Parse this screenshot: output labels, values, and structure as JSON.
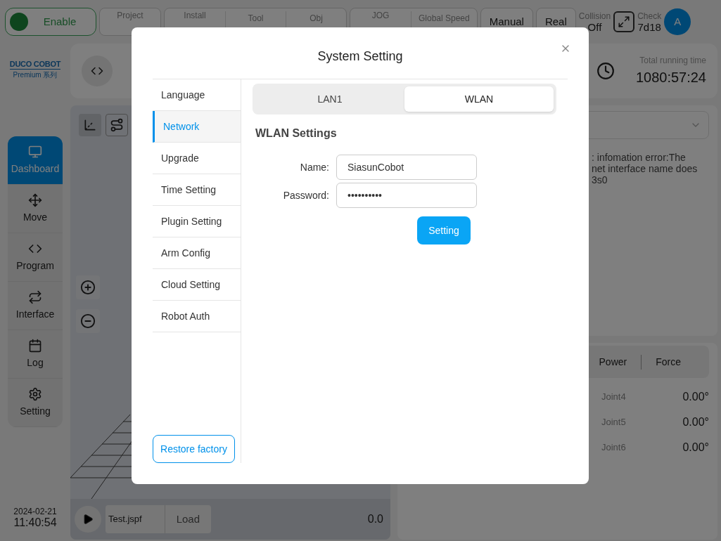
{
  "top_bar": {
    "enable": {
      "label": "Enable",
      "on": true
    },
    "groups": [
      {
        "fields": [
          {
            "label": "Project"
          }
        ]
      },
      {
        "fields": [
          {
            "label": "Install"
          },
          {
            "label": "Tool"
          },
          {
            "label": "Obj"
          }
        ]
      },
      {
        "fields": [
          {
            "label": "JOG"
          },
          {
            "label": "Global Speed"
          }
        ]
      }
    ],
    "mode_buttons": [
      "Manual",
      "Real"
    ],
    "collision": {
      "label": "Collision",
      "value": "Off"
    },
    "check": {
      "label": "Check",
      "value": "7d18"
    },
    "avatar": "A"
  },
  "logo": {
    "brand": "DUCO COBOT",
    "series": "Premium 系列"
  },
  "nav": [
    {
      "label": "Dashboard",
      "selected": true
    },
    {
      "label": "Move",
      "selected": false
    },
    {
      "label": "Program",
      "selected": false
    },
    {
      "label": "Interface",
      "selected": false
    },
    {
      "label": "Log",
      "selected": false
    },
    {
      "label": "Setting",
      "selected": false
    }
  ],
  "datetime": {
    "date": "2024-02-21",
    "time": "11:40:54"
  },
  "running_time": {
    "label": "Total running time",
    "value": "1080:57:24"
  },
  "log_message": [
    ": infomation error:The",
    "net interface name does",
    "3s0"
  ],
  "joint_tabs": [
    "Power",
    "Force"
  ],
  "joints": [
    {
      "name": "Joint4",
      "value": "0.00°"
    },
    {
      "name": "Joint5",
      "value": "0.00°"
    },
    {
      "name": "Joint6",
      "value": "0.00°"
    }
  ],
  "player": {
    "file": "Test.jspf",
    "load": "Load",
    "progress": "0.0"
  },
  "dialog": {
    "title": "System Setting",
    "menu": [
      {
        "label": "Language",
        "selected": false
      },
      {
        "label": "Network",
        "selected": true
      },
      {
        "label": "Upgrade",
        "selected": false
      },
      {
        "label": "Time Setting",
        "selected": false
      },
      {
        "label": "Plugin Setting",
        "selected": false
      },
      {
        "label": "Arm Config",
        "selected": false
      },
      {
        "label": "Cloud Setting",
        "selected": false
      },
      {
        "label": "Robot Auth",
        "selected": false
      }
    ],
    "restore_button": "Restore factory",
    "tabs": [
      {
        "label": "LAN1",
        "selected": false
      },
      {
        "label": "WLAN",
        "selected": true
      }
    ],
    "section_title": "WLAN Settings",
    "fields": [
      {
        "label": "Name:",
        "value": "SiasunCobot"
      },
      {
        "label": "Password:",
        "value": "••••••••••"
      }
    ],
    "submit": "Setting"
  }
}
